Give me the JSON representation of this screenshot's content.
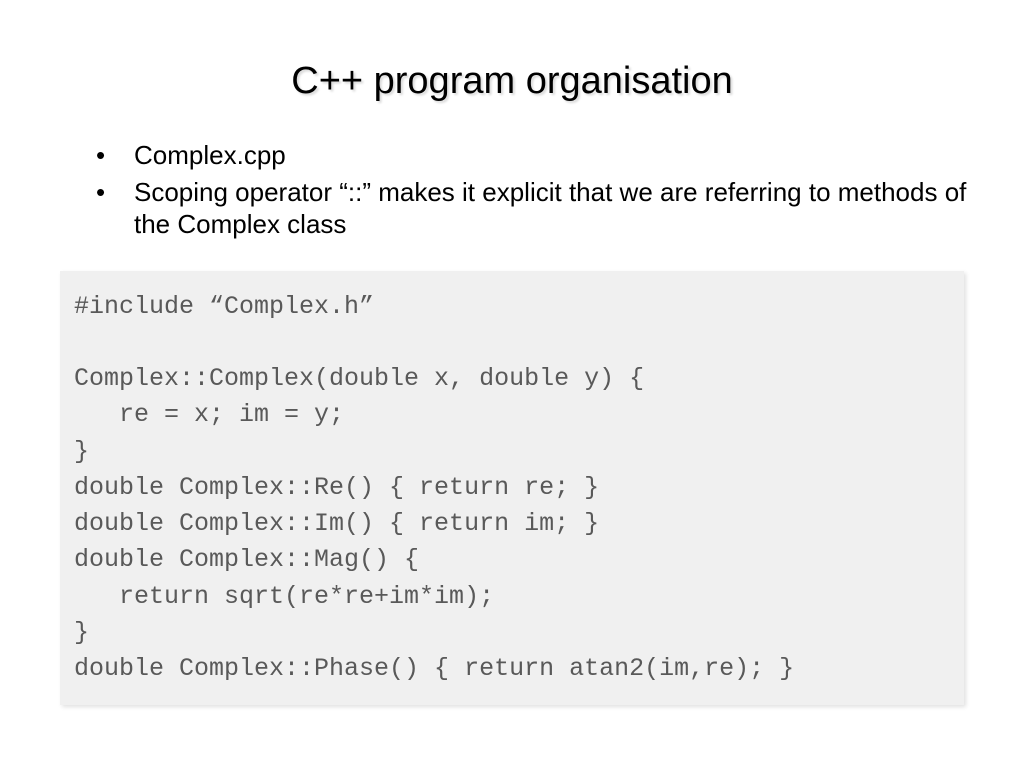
{
  "title": "C++ program organisation",
  "bullets": [
    "Complex.cpp",
    "Scoping operator “::” makes it explicit that we are referring to methods of the Complex class"
  ],
  "code": "#include “Complex.h”\n\nComplex::Complex(double x, double y) {\n   re = x; im = y;\n}\ndouble Complex::Re() { return re; }\ndouble Complex::Im() { return im; }\ndouble Complex::Mag() {\n   return sqrt(re*re+im*im);\n}\ndouble Complex::Phase() { return atan2(im,re); }"
}
